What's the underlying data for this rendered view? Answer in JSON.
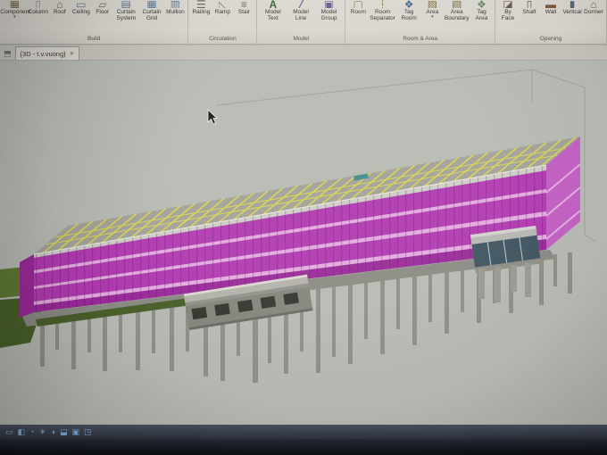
{
  "ribbon": {
    "panels": [
      {
        "label": "Build",
        "buttons": [
          {
            "label": "Component",
            "icon": "component-icon",
            "dropdown": true
          },
          {
            "label": "Column",
            "icon": "column-icon"
          },
          {
            "label": "Roof",
            "icon": "roof-icon"
          },
          {
            "label": "Ceiling",
            "icon": "ceiling-icon"
          },
          {
            "label": "Floor",
            "icon": "floor-icon"
          },
          {
            "label": "Curtain System",
            "icon": "curtain-system-icon"
          },
          {
            "label": "Curtain Grid",
            "icon": "curtain-grid-icon"
          },
          {
            "label": "Mullion",
            "icon": "mullion-icon"
          }
        ]
      },
      {
        "label": "Circulation",
        "buttons": [
          {
            "label": "Railing",
            "icon": "railing-icon"
          },
          {
            "label": "Ramp",
            "icon": "ramp-icon"
          },
          {
            "label": "Stair",
            "icon": "stair-icon"
          }
        ]
      },
      {
        "label": "Model",
        "buttons": [
          {
            "label": "Model Text",
            "icon": "model-text-icon"
          },
          {
            "label": "Model Line",
            "icon": "model-line-icon"
          },
          {
            "label": "Model Group",
            "icon": "model-group-icon"
          }
        ]
      },
      {
        "label": "Room & Area",
        "buttons": [
          {
            "label": "Room",
            "icon": "room-icon"
          },
          {
            "label": "Room Separator",
            "icon": "room-separator-icon"
          },
          {
            "label": "Tag Room",
            "icon": "tag-room-icon"
          },
          {
            "label": "Area",
            "icon": "area-icon",
            "dropdown": true
          },
          {
            "label": "Area Boundary",
            "icon": "area-boundary-icon"
          },
          {
            "label": "Tag Area",
            "icon": "tag-area-icon"
          }
        ]
      },
      {
        "label": "Opening",
        "buttons": [
          {
            "label": "By Face",
            "icon": "by-face-icon"
          },
          {
            "label": "Shaft",
            "icon": "shaft-icon"
          },
          {
            "label": "Wall",
            "icon": "wall-icon"
          },
          {
            "label": "Vertical",
            "icon": "vertical-icon"
          },
          {
            "label": "Dormer",
            "icon": "dormer-icon"
          }
        ]
      }
    ]
  },
  "tabbar": {
    "active_tab": "{3D - t.v.vuong}",
    "close_glyph": "✕"
  },
  "viewbar": {
    "icons": [
      {
        "name": "scale-icon",
        "glyph": "▭"
      },
      {
        "name": "detail-level-icon",
        "glyph": "◧"
      },
      {
        "name": "visual-style-icon",
        "glyph": "◔"
      },
      {
        "name": "sun-path-icon",
        "glyph": "☀"
      },
      {
        "name": "shadows-icon",
        "glyph": "◑"
      },
      {
        "name": "crop-region-icon",
        "glyph": "⬓"
      },
      {
        "name": "crop-visibility-icon",
        "glyph": "▣"
      },
      {
        "name": "view-lock-icon",
        "glyph": "◳"
      }
    ]
  },
  "colors": {
    "wall_magenta": "#b13ab1",
    "wall_dark": "#9a2a9a",
    "slab_pink": "#e3abdf",
    "end_face": "#c25fc2",
    "roof_gray": "#a2a29a",
    "partition_yellow": "#d9d44f",
    "terrain_green": "#5e7a34",
    "terrain_dark": "#49602a",
    "pile_gray": "#8f8f88",
    "annex_dark": "#3f5560",
    "canvas_bg": "#b7bab3",
    "ribbon_bg": "#d9d6cf",
    "viewbar_bg": "#2e3440",
    "accent_blue": "#7fb0dd"
  }
}
